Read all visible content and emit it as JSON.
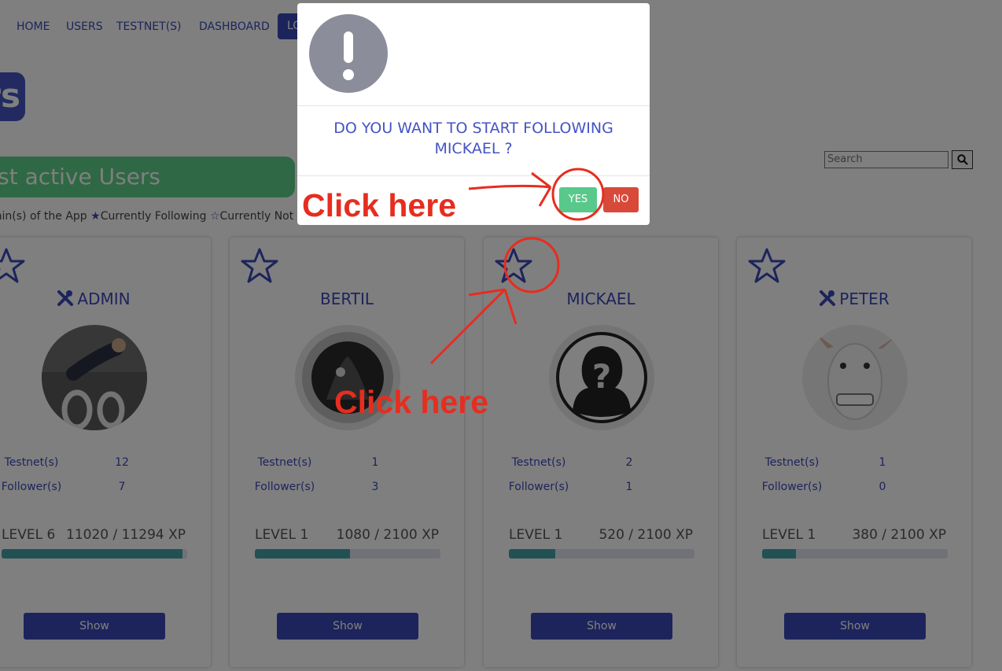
{
  "nav": {
    "items": [
      "HOME",
      "USERS",
      "TESTNET(S)",
      "DASHBOARD"
    ],
    "login_label": "LO"
  },
  "page": {
    "title_fragment": "rs",
    "banner": "ost active Users",
    "legend": {
      "admins": "dmin(s) of the App",
      "following": "Currently Following",
      "not_following": "Currently Not"
    }
  },
  "search": {
    "placeholder": "Search"
  },
  "users": [
    {
      "name": "ADMIN",
      "admin": true,
      "testnets_label": "Testnet(s)",
      "testnets": "12",
      "followers_label": "Follower(s)",
      "followers": "7",
      "level": "LEVEL 6",
      "xp": "11020 / 11294 XP",
      "progress": 0.976,
      "show": "Show"
    },
    {
      "name": "BERTIL",
      "admin": false,
      "testnets_label": "Testnet(s)",
      "testnets": "1",
      "followers_label": "Follower(s)",
      "followers": "3",
      "level": "LEVEL 1",
      "xp": "1080 / 2100 XP",
      "progress": 0.514,
      "show": "Show"
    },
    {
      "name": "MICKAEL",
      "admin": false,
      "testnets_label": "Testnet(s)",
      "testnets": "2",
      "followers_label": "Follower(s)",
      "followers": "1",
      "level": "LEVEL 1",
      "xp": "520 / 2100 XP",
      "progress": 0.248,
      "show": "Show"
    },
    {
      "name": "PETER",
      "admin": true,
      "testnets_label": "Testnet(s)",
      "testnets": "1",
      "followers_label": "Follower(s)",
      "followers": "0",
      "level": "LEVEL 1",
      "xp": "380 / 2100 XP",
      "progress": 0.181,
      "show": "Show"
    }
  ],
  "modal": {
    "icon": "exclamation-icon",
    "question": "DO YOU WANT TO START FOLLOWING MICKAEL ?",
    "yes_label": "YES",
    "no_label": "NO"
  },
  "annotations": {
    "click_here_1": "Click here",
    "click_here_2": "Click here",
    "color": "#e62d1f"
  },
  "colors": {
    "primary": "#3a49b8",
    "success": "#58c98b",
    "danger": "#d9493a",
    "progress": "#44a3a8",
    "banner": "#5ed188"
  }
}
